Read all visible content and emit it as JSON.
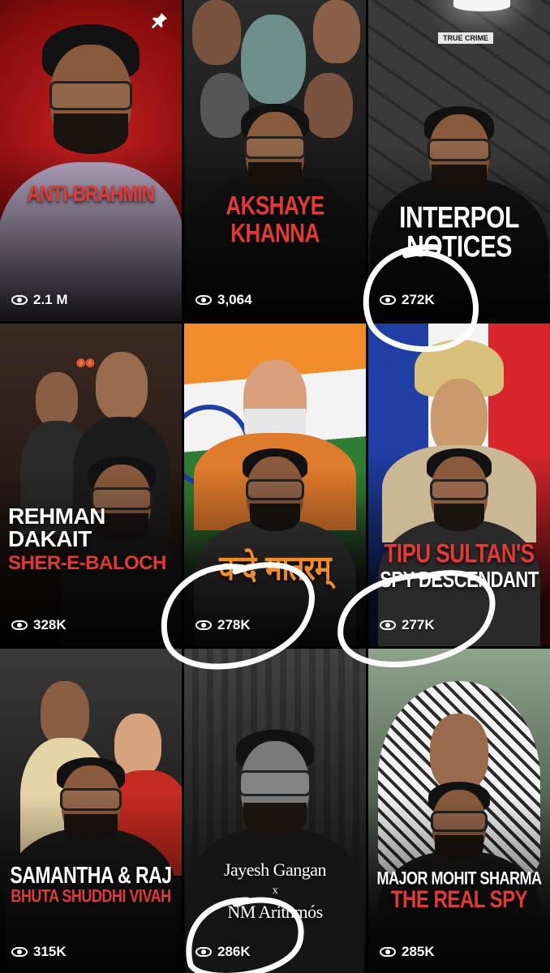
{
  "tiles": [
    {
      "title_line1": "ANTI-BRAHMIN",
      "title_line2": "",
      "views": "2.1 M",
      "pinned": true
    },
    {
      "title_line1": "AKSHAYE",
      "title_line2": "KHANNA",
      "views": "3,064",
      "pinned": false
    },
    {
      "badge": "TRUE CRIME",
      "title_line1": "INTERPOL",
      "title_line2": "NOTICES",
      "views": "272K",
      "pinned": false
    },
    {
      "title_line1": "REHMAN",
      "title_line2": "DAKAIT",
      "title_line3": "SHER-E-BALOCH",
      "views": "328K",
      "pinned": false
    },
    {
      "title_line1": "वन्दे मातरम्",
      "views": "278K",
      "pinned": false
    },
    {
      "title_line1": "TIPU SULTAN'S",
      "title_line2": "SPY DESCENDANT",
      "views": "277K",
      "pinned": false
    },
    {
      "title_line1": "SAMANTHA & RAJ",
      "title_line2": "BHUTA SHUDDHI VIVAH",
      "views": "315K",
      "pinned": false
    },
    {
      "title_line1": "Jayesh Gangan",
      "title_line2": "x",
      "title_line3": "NM Arithmós",
      "views": "286K",
      "pinned": false
    },
    {
      "title_line1": "MAJOR MOHIT SHARMA",
      "title_line2": "THE REAL SPY",
      "views": "285K",
      "pinned": false
    }
  ],
  "colors": {
    "accent_red": "#e53935",
    "flag_saffron": "#f08c2a",
    "flag_green": "#2e7d32",
    "flag_blue": "#1f3fa6"
  },
  "icons": {
    "views": "eye-icon",
    "pinned": "pin-icon"
  }
}
